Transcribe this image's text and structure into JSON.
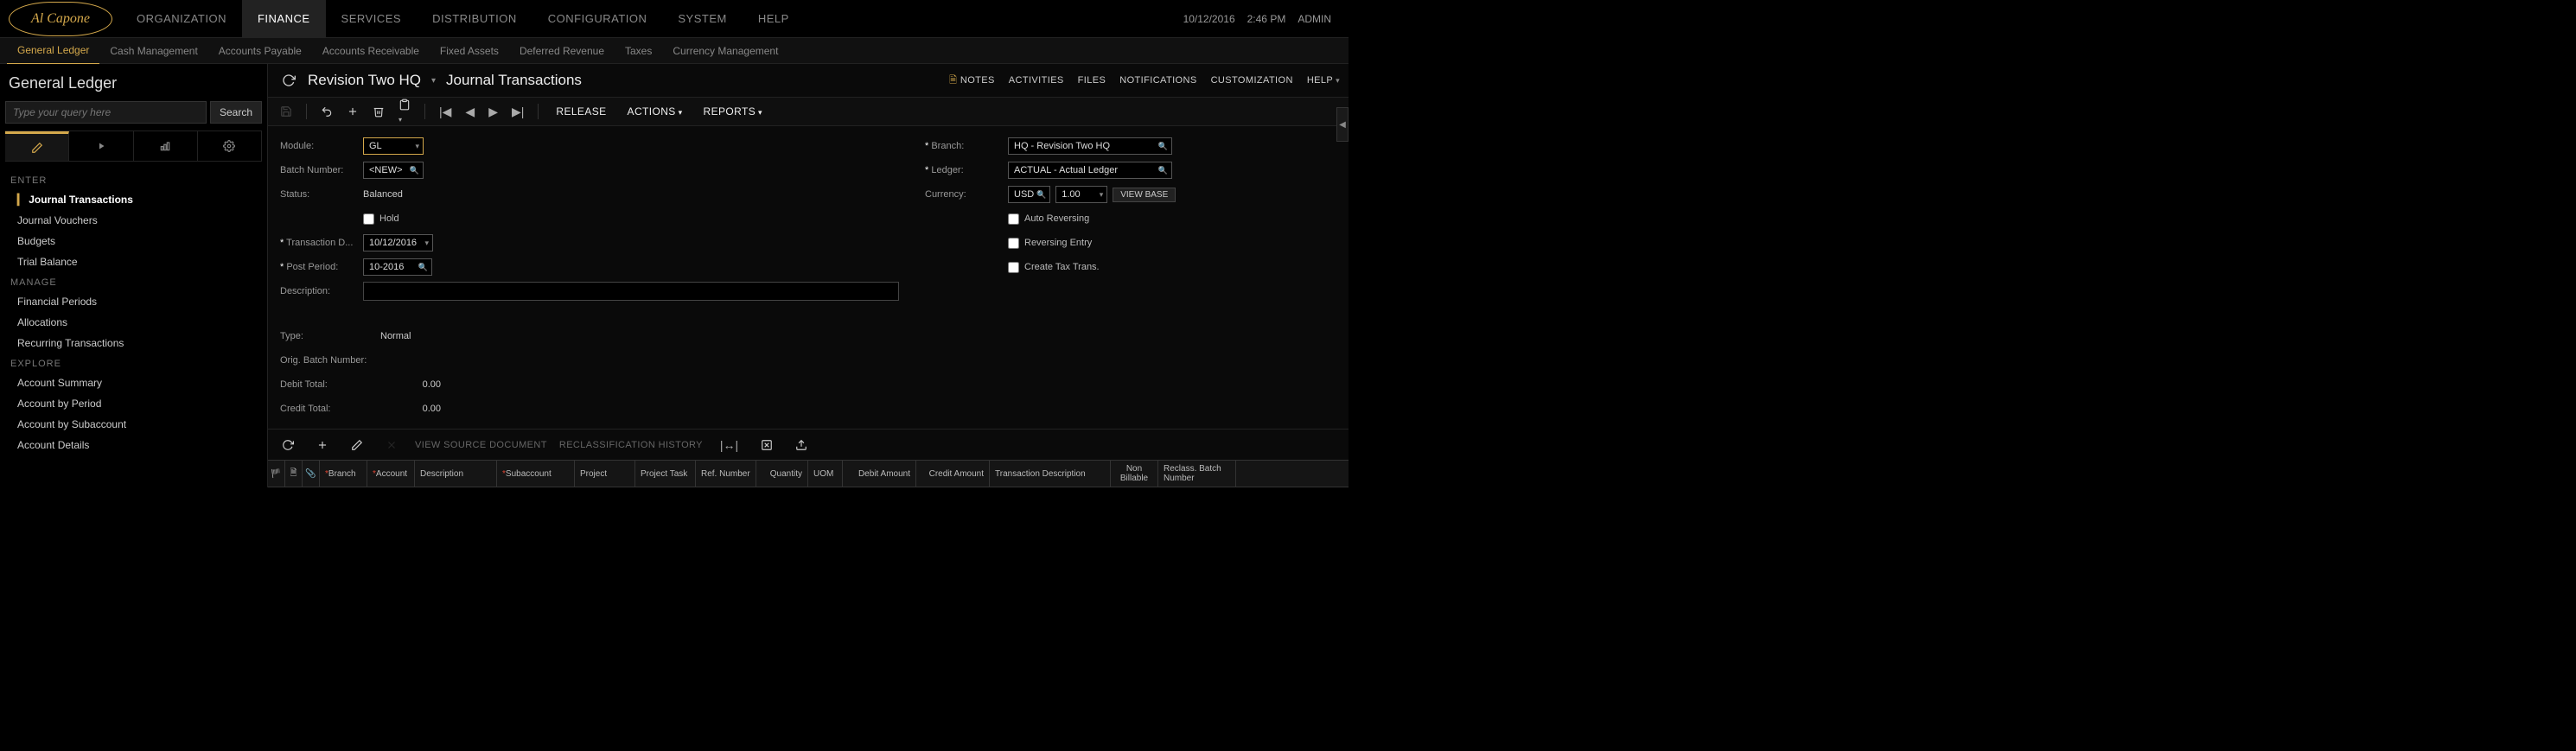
{
  "topbar": {
    "logo_text": "Al Capone",
    "date": "10/12/2016",
    "time": "2:46 PM",
    "user": "ADMIN"
  },
  "main_nav": [
    "ORGANIZATION",
    "FINANCE",
    "SERVICES",
    "DISTRIBUTION",
    "CONFIGURATION",
    "SYSTEM",
    "HELP"
  ],
  "main_nav_active": 1,
  "sub_nav": [
    "General Ledger",
    "Cash Management",
    "Accounts Payable",
    "Accounts Receivable",
    "Fixed Assets",
    "Deferred Revenue",
    "Taxes",
    "Currency Management"
  ],
  "sub_nav_active": 0,
  "sidebar": {
    "title": "General Ledger",
    "search_placeholder": "Type your query here",
    "search_btn": "Search",
    "sections": [
      {
        "heading": "ENTER",
        "items": [
          "Journal Transactions",
          "Journal Vouchers",
          "Budgets",
          "Trial Balance"
        ],
        "active": 0
      },
      {
        "heading": "MANAGE",
        "items": [
          "Financial Periods",
          "Allocations",
          "Recurring Transactions"
        ]
      },
      {
        "heading": "EXPLORE",
        "items": [
          "Account Summary",
          "Account by Period",
          "Account by Subaccount",
          "Account Details"
        ]
      }
    ]
  },
  "breadcrumb": {
    "org": "Revision Two HQ",
    "page": "Journal Transactions"
  },
  "right_links": {
    "notes": "NOTES",
    "activities": "ACTIVITIES",
    "files": "FILES",
    "notifications": "NOTIFICATIONS",
    "customization": "CUSTOMIZATION",
    "help": "HELP"
  },
  "toolbar": {
    "release": "RELEASE",
    "actions": "ACTIONS",
    "reports": "REPORTS"
  },
  "form": {
    "module": {
      "label": "Module:",
      "value": "GL"
    },
    "batch_number": {
      "label": "Batch Number:",
      "value": "<NEW>"
    },
    "status": {
      "label": "Status:",
      "value": "Balanced"
    },
    "hold": {
      "label": "Hold"
    },
    "transaction_date": {
      "label": "Transaction D...",
      "value": "10/12/2016"
    },
    "post_period": {
      "label": "Post Period:",
      "value": "10-2016"
    },
    "description": {
      "label": "Description:"
    },
    "branch": {
      "label": "Branch:",
      "value": "HQ - Revision Two HQ"
    },
    "ledger": {
      "label": "Ledger:",
      "value": "ACTUAL - Actual Ledger"
    },
    "currency": {
      "label": "Currency:",
      "value": "USD",
      "rate": "1.00",
      "view_base": "VIEW BASE"
    },
    "auto_reversing": {
      "label": "Auto Reversing"
    },
    "reversing_entry": {
      "label": "Reversing Entry"
    },
    "create_tax": {
      "label": "Create Tax Trans."
    },
    "type": {
      "label": "Type:",
      "value": "Normal"
    },
    "orig_batch": {
      "label": "Orig. Batch Number:"
    },
    "debit_total": {
      "label": "Debit Total:",
      "value": "0.00"
    },
    "credit_total": {
      "label": "Credit Total:",
      "value": "0.00"
    }
  },
  "grid_toolbar": {
    "view_source": "VIEW SOURCE DOCUMENT",
    "reclass": "RECLASSIFICATION HISTORY"
  },
  "grid_columns": [
    "Branch",
    "Account",
    "Description",
    "Subaccount",
    "Project",
    "Project Task",
    "Ref. Number",
    "Quantity",
    "UOM",
    "Debit Amount",
    "Credit Amount",
    "Transaction Description",
    "Non Billable",
    "Reclass. Batch Number"
  ]
}
